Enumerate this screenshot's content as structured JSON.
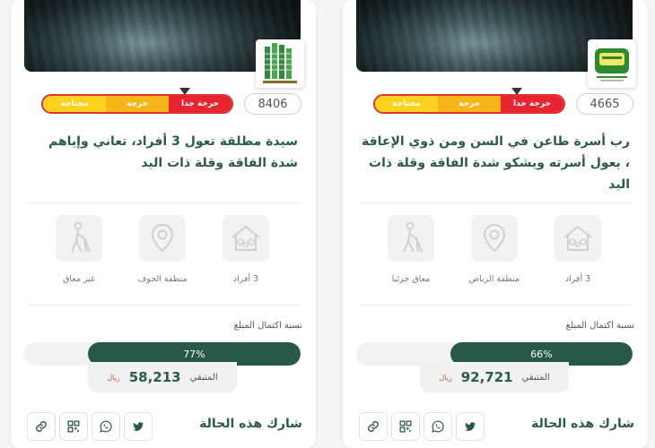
{
  "cards": [
    {
      "case_id": "4665",
      "severity_levels": [
        "محتاجة",
        "حرجة",
        "حرجة جدا"
      ],
      "title": "رب أسرة طاعن في السن ومن ذوي الإعاقة ، يعول أسرته ويشكو شدة الفاقة وقلة ذات اليد",
      "features": {
        "family": "3 أفراد",
        "region": "منطقة الرياض",
        "disability": "معاق جزئيا"
      },
      "completion_label": "نسبة اكتمال المبلغ",
      "progress_percent": 66,
      "progress_text": "66%",
      "remaining_label": "المتبقي",
      "remaining_value": "92,721",
      "currency": "ريال",
      "share_title": "شارك هذه الحالة",
      "org_logo_icon": "green-charity-logo"
    },
    {
      "case_id": "8406",
      "severity_levels": [
        "محتاجة",
        "حرجة",
        "حرجة جدا"
      ],
      "title": "سيدة مطلقة تعول 3 أفراد، تعاني وإياهم شدة الفاقة وقلة ذات اليد",
      "features": {
        "family": "3 أفراد",
        "region": "منطقة الجوف",
        "disability": "غير معاق"
      },
      "completion_label": "نسبة اكتمال المبلغ",
      "progress_percent": 77,
      "progress_text": "77%",
      "remaining_label": "المتبقي",
      "remaining_value": "58,213",
      "currency": "ريال",
      "share_title": "شارك هذه الحالة",
      "org_logo_icon": "building-towers-logo"
    }
  ],
  "colors": {
    "brand_green": "#285847",
    "title_green": "#2c5b4b",
    "severity_red": "#e82431",
    "severity_orange": "#f7b519",
    "severity_yellow": "#ffd21f",
    "currency_orange": "#c2592e"
  },
  "icons": {
    "share_buttons": [
      "link-icon",
      "qr-code-icon",
      "whatsapp-icon",
      "twitter-icon"
    ],
    "features": [
      "disabled-person-icon",
      "location-pin-icon",
      "family-house-icon"
    ]
  }
}
